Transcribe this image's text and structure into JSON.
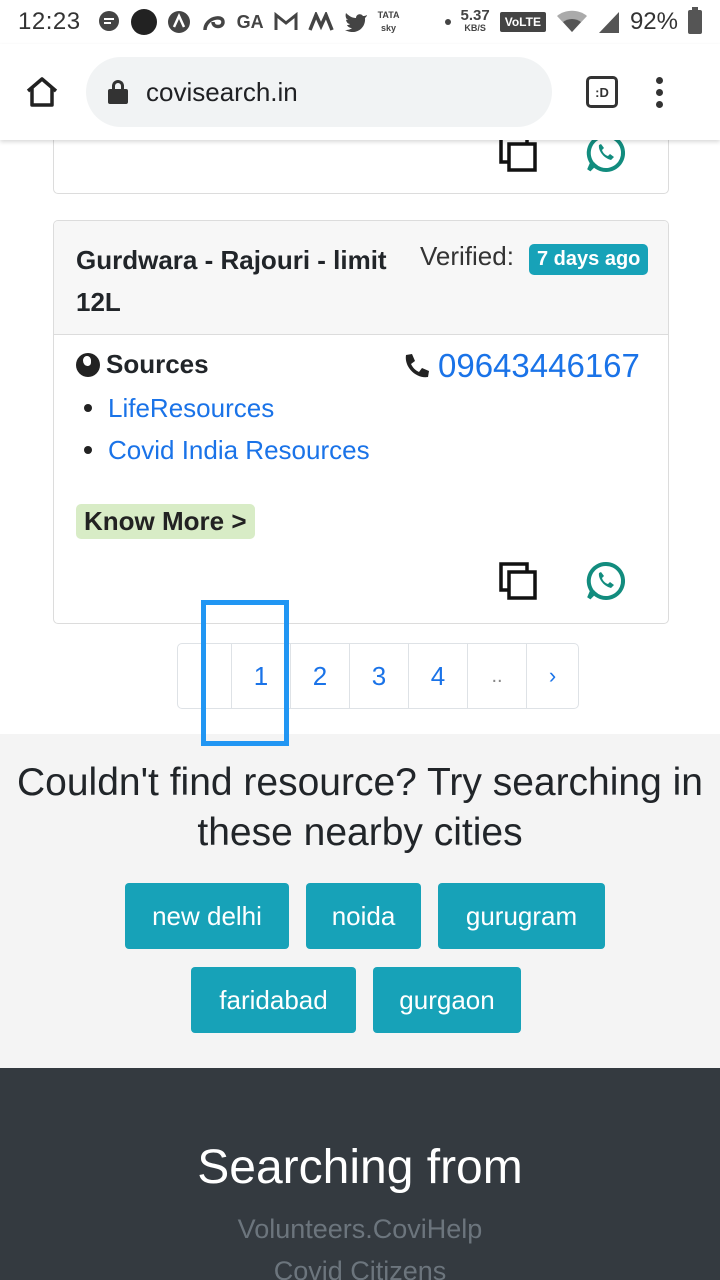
{
  "status_bar": {
    "time": "12:23",
    "speed_value": "5.37",
    "speed_unit": "KB/S",
    "network_badge": "VoLTE",
    "battery": "92%",
    "icons": [
      "message-icon",
      "circle-icon",
      "arc-icon",
      "swirl-icon",
      "ga-icon",
      "gmail-icon",
      "m-icon",
      "twitter-icon",
      "tatasky-icon",
      "wifi-icon",
      "signal-icon",
      "battery-icon"
    ],
    "tata_label": "TATA",
    "sky_label": "sky",
    "ga_label": "GA"
  },
  "browser": {
    "url": "covisearch.in",
    "tab_label": ":D"
  },
  "resource_card": {
    "title": "Gurdwara - Rajouri - limit 12L",
    "verified_label": "Verified:",
    "verified_badge": "7 days ago",
    "sources_heading": "Sources",
    "phone": "09643446167",
    "sources": [
      "LifeResources",
      "Covid India Resources"
    ],
    "know_more": "Know More >"
  },
  "pagination": {
    "pages": [
      "1",
      "2",
      "3",
      "4",
      "..",
      "›"
    ],
    "active_page": "1"
  },
  "nearby": {
    "heading": "Couldn't find resource? Try searching in these nearby cities",
    "cities": [
      "new delhi",
      "noida",
      "gurugram",
      "faridabad",
      "gurgaon"
    ]
  },
  "footer": {
    "heading": "Searching from",
    "links": [
      "Volunteers.CoviHelp",
      "Covid Citizens"
    ]
  },
  "colors": {
    "accent": "#17a2b8",
    "link": "#1a73e8",
    "whatsapp": "#128c7e",
    "know_more_bg": "#d8ecc6",
    "footer_bg": "#343a40",
    "highlight": "#2196f3"
  }
}
